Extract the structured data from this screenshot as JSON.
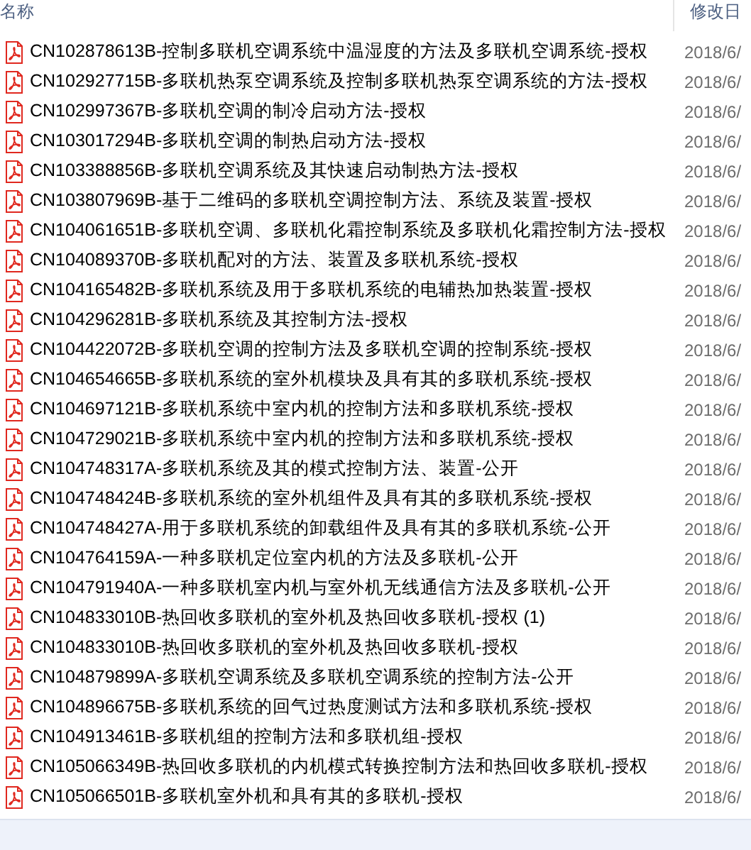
{
  "columns": [
    "名称",
    "修改日"
  ],
  "files": [
    {
      "name": "CN102878613B-控制多联机空调系统中温湿度的方法及多联机空调系统-授权",
      "date": "2018/6/"
    },
    {
      "name": "CN102927715B-多联机热泵空调系统及控制多联机热泵空调系统的方法-授权",
      "date": "2018/6/"
    },
    {
      "name": "CN102997367B-多联机空调的制冷启动方法-授权",
      "date": "2018/6/"
    },
    {
      "name": "CN103017294B-多联机空调的制热启动方法-授权",
      "date": "2018/6/"
    },
    {
      "name": "CN103388856B-多联机空调系统及其快速启动制热方法-授权",
      "date": "2018/6/"
    },
    {
      "name": "CN103807969B-基于二维码的多联机空调控制方法、系统及装置-授权",
      "date": "2018/6/"
    },
    {
      "name": "CN104061651B-多联机空调、多联机化霜控制系统及多联机化霜控制方法-授权",
      "date": "2018/6/"
    },
    {
      "name": "CN104089370B-多联机配对的方法、装置及多联机系统-授权",
      "date": "2018/6/"
    },
    {
      "name": "CN104165482B-多联机系统及用于多联机系统的电辅热加热装置-授权",
      "date": "2018/6/"
    },
    {
      "name": "CN104296281B-多联机系统及其控制方法-授权",
      "date": "2018/6/"
    },
    {
      "name": "CN104422072B-多联机空调的控制方法及多联机空调的控制系统-授权",
      "date": "2018/6/"
    },
    {
      "name": "CN104654665B-多联机系统的室外机模块及具有其的多联机系统-授权",
      "date": "2018/6/"
    },
    {
      "name": "CN104697121B-多联机系统中室内机的控制方法和多联机系统-授权",
      "date": "2018/6/"
    },
    {
      "name": "CN104729021B-多联机系统中室内机的控制方法和多联机系统-授权",
      "date": "2018/6/"
    },
    {
      "name": "CN104748317A-多联机系统及其的模式控制方法、装置-公开",
      "date": "2018/6/"
    },
    {
      "name": "CN104748424B-多联机系统的室外机组件及具有其的多联机系统-授权",
      "date": "2018/6/"
    },
    {
      "name": "CN104748427A-用于多联机系统的卸载组件及具有其的多联机系统-公开",
      "date": "2018/6/"
    },
    {
      "name": "CN104764159A-一种多联机定位室内机的方法及多联机-公开",
      "date": "2018/6/"
    },
    {
      "name": "CN104791940A-一种多联机室内机与室外机无线通信方法及多联机-公开",
      "date": "2018/6/"
    },
    {
      "name": "CN104833010B-热回收多联机的室外机及热回收多联机-授权 (1)",
      "date": "2018/6/"
    },
    {
      "name": "CN104833010B-热回收多联机的室外机及热回收多联机-授权",
      "date": "2018/6/"
    },
    {
      "name": "CN104879899A-多联机空调系统及多联机空调系统的控制方法-公开",
      "date": "2018/6/"
    },
    {
      "name": "CN104896675B-多联机系统的回气过热度测试方法和多联机系统-授权",
      "date": "2018/6/"
    },
    {
      "name": "CN104913461B-多联机组的控制方法和多联机组-授权",
      "date": "2018/6/"
    },
    {
      "name": "CN105066349B-热回收多联机的内机模式转换控制方法和热回收多联机-授权",
      "date": "2018/6/"
    },
    {
      "name": "CN105066501B-多联机室外机和具有其的多联机-授权",
      "date": "2018/6/"
    }
  ]
}
